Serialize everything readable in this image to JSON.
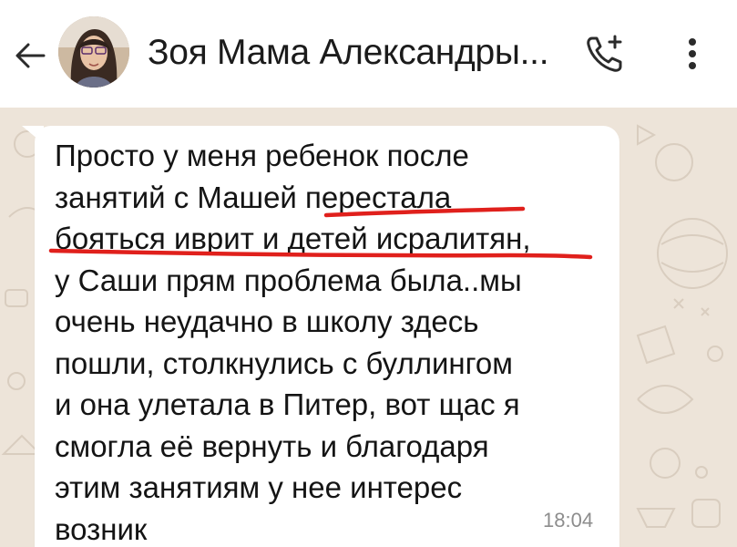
{
  "header": {
    "contact_name": "Зоя Мама Александры...",
    "back_icon": "arrow-left-icon",
    "add_call_icon": "phone-plus-icon",
    "menu_icon": "more-vertical-icon"
  },
  "message": {
    "lines": [
      "Просто у меня ребенок после",
      "занятий с Машей перестала",
      "бояться иврит и детей исралитян,",
      "у Саши прям проблема была..мы",
      "очень неудачно в школу здесь",
      "пошли, столкнулись с буллингом",
      "и она улетала в Питер, вот щас я",
      "смогла её вернуть и благодаря",
      "этим занятиям у нее интерес",
      "возник"
    ],
    "time": "18:04",
    "annotation_color": "#e0201c"
  },
  "colors": {
    "header_bg": "#ffffff",
    "chat_bg": "#ede4d9",
    "bubble_bg": "#ffffff",
    "timestamp": "#8d8d8d"
  }
}
